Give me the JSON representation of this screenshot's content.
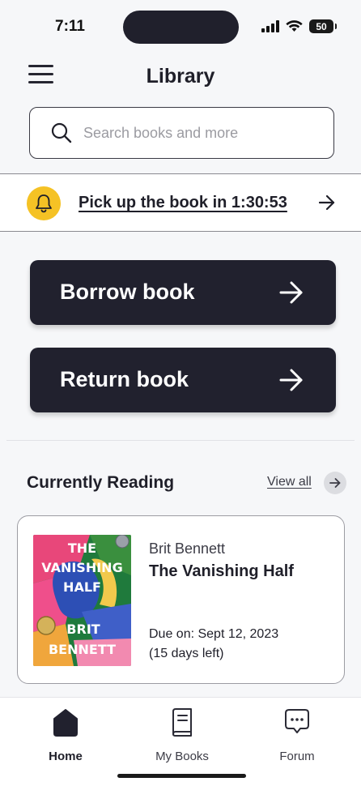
{
  "status_bar": {
    "time": "7:11",
    "battery": "50"
  },
  "header": {
    "title": "Library",
    "menu_icon": "hamburger-menu-icon"
  },
  "search": {
    "placeholder": "Search books and more",
    "value": ""
  },
  "notification": {
    "text": "Pick up the book in 1:30:53",
    "icon": "bell-icon"
  },
  "actions": {
    "borrow_label": "Borrow book",
    "return_label": "Return book"
  },
  "currently_reading": {
    "title": "Currently Reading",
    "view_all": "View all",
    "book": {
      "author": "Brit Bennett",
      "title": "The Vanishing Half",
      "due": "Due on: Sept 12, 2023",
      "days_left": "(15 days left)",
      "cover_title_line1": "THE",
      "cover_title_line2": "VANISHING",
      "cover_title_line3": "HALF",
      "cover_author_line1": "BRIT",
      "cover_author_line2": "BENNETT"
    }
  },
  "nav": {
    "items": [
      {
        "label": "Home",
        "icon": "home-icon",
        "active": true
      },
      {
        "label": "My Books",
        "icon": "book-icon",
        "active": false
      },
      {
        "label": "Forum",
        "icon": "chat-bubble-icon",
        "active": false
      }
    ]
  },
  "colors": {
    "primary_dark": "#21212e",
    "accent_yellow": "#f5c225",
    "background": "#f6f7f9"
  }
}
